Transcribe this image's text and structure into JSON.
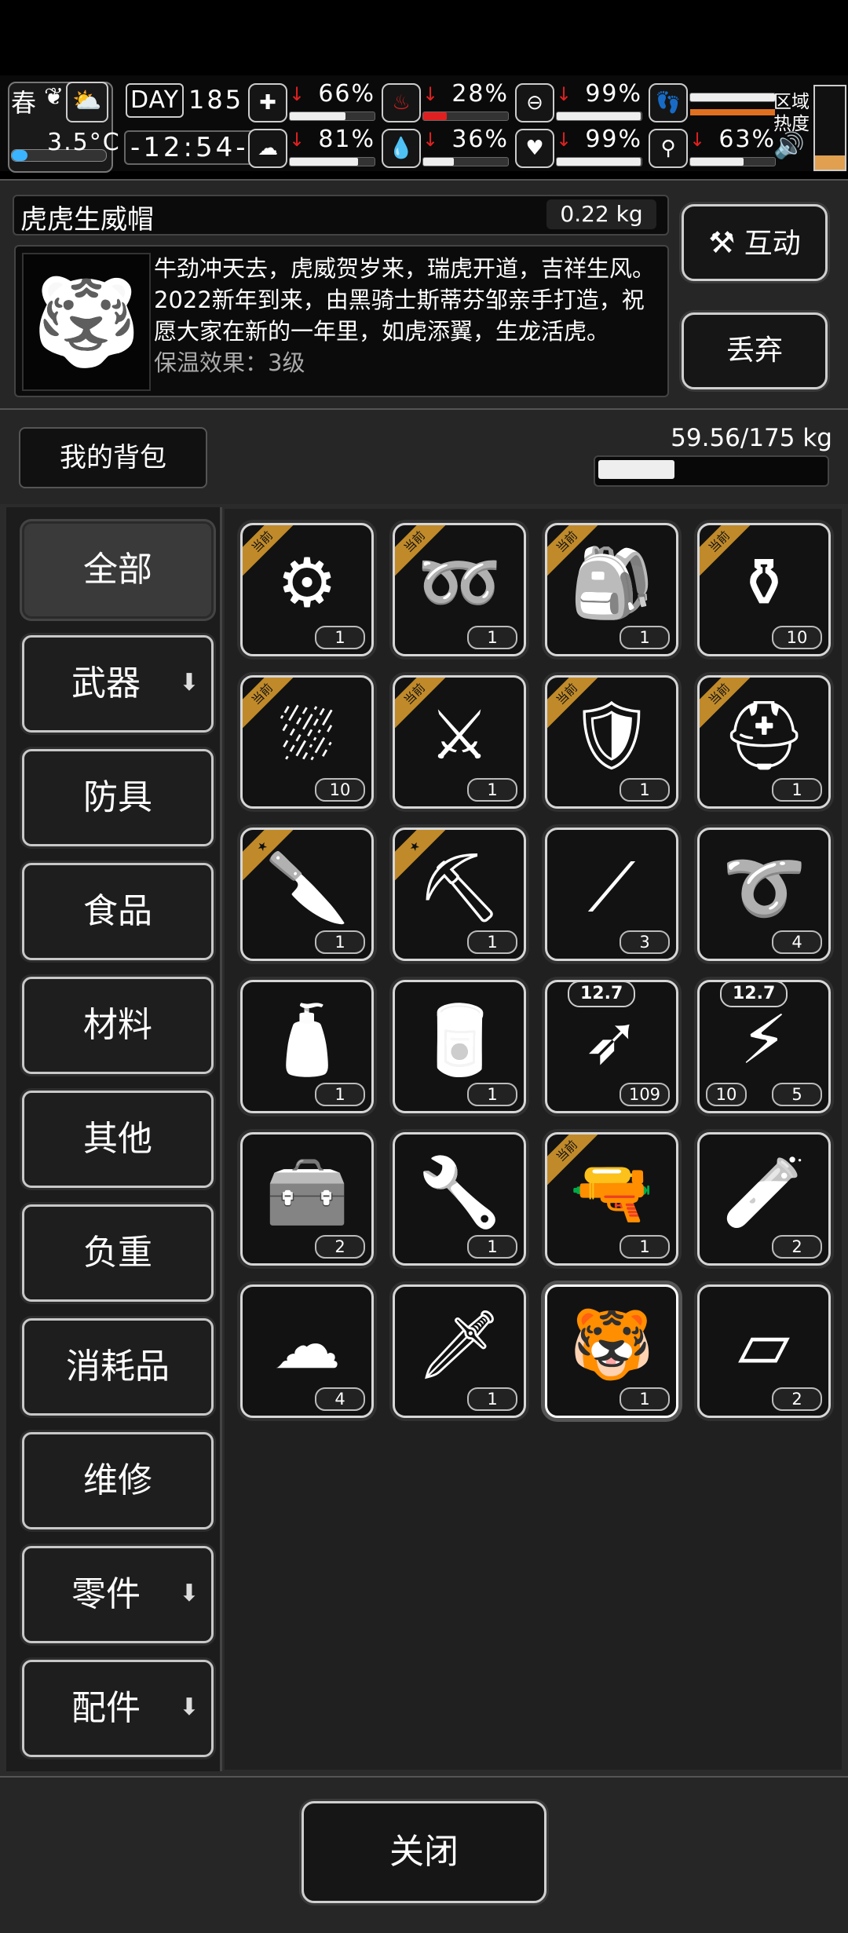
{
  "status": {
    "season": "春",
    "temperature": "3.5°C",
    "day_label": "DAY",
    "day_number": "185",
    "clock": "-12:54-",
    "stats": [
      {
        "icon": "medkit-icon",
        "value": "66%",
        "fill": 0.66
      },
      {
        "icon": "stomach-icon",
        "value": "28%",
        "fill": 0.28
      },
      {
        "icon": "bladder-icon",
        "value": "99%",
        "fill": 0.99
      },
      {
        "icon": "stamina-foot-icon",
        "value": "",
        "fill": 1.0
      },
      {
        "icon": "brain-icon",
        "value": "81%",
        "fill": 0.81
      },
      {
        "icon": "water-drop-icon",
        "value": "36%",
        "fill": 0.36
      },
      {
        "icon": "heart-icon",
        "value": "99%",
        "fill": 0.99
      },
      {
        "icon": "fatigue-icon",
        "value": "63%",
        "fill": 0.63
      }
    ],
    "region_heat_label": "区域\n热度",
    "sound_icon": "speaker-icon"
  },
  "item": {
    "name": "虎虎生威帽",
    "weight": "0.22 kg",
    "description": "牛劲冲天去，虎威贺岁来，瑞虎开道，吉祥生风。2022新年到来，由黑骑士斯蒂芬邹亲手打造，祝愿大家在新的一年里，如虎添翼，生龙活虎。",
    "description_cut": "保温效果：3级",
    "interact_label": "互动",
    "discard_label": "丢弃"
  },
  "bag": {
    "title": "我的背包",
    "weight_text": "59.56/175 kg",
    "fill": 0.34
  },
  "categories": [
    {
      "label": "全部",
      "selected": true,
      "arrow": false
    },
    {
      "label": "武器",
      "selected": false,
      "arrow": true
    },
    {
      "label": "防具",
      "selected": false,
      "arrow": false
    },
    {
      "label": "食品",
      "selected": false,
      "arrow": false
    },
    {
      "label": "材料",
      "selected": false,
      "arrow": false
    },
    {
      "label": "其他",
      "selected": false,
      "arrow": false
    },
    {
      "label": "负重",
      "selected": false,
      "arrow": false
    },
    {
      "label": "消耗品",
      "selected": false,
      "arrow": false
    },
    {
      "label": "维修",
      "selected": false,
      "arrow": false
    },
    {
      "label": "零件",
      "selected": false,
      "arrow": true
    },
    {
      "label": "配件",
      "selected": false,
      "arrow": true
    }
  ],
  "items": [
    {
      "glyph": "⚙",
      "icon": "tripod-icon",
      "count": "1",
      "tag": "当前"
    },
    {
      "glyph": "➿",
      "icon": "rope-whip-icon",
      "count": "1",
      "tag": "当前"
    },
    {
      "glyph": "🎒",
      "icon": "backpack-icon",
      "count": "1",
      "tag": "当前"
    },
    {
      "glyph": "⚱",
      "icon": "grenade-icon",
      "count": "10",
      "tag": "当前"
    },
    {
      "glyph": "⛆",
      "icon": "net-icon",
      "count": "10",
      "tag": "当前"
    },
    {
      "glyph": "⚔",
      "icon": "armor-gauntlet-icon",
      "count": "1",
      "tag": "当前"
    },
    {
      "glyph": "🛡",
      "icon": "body-armor-icon",
      "count": "1",
      "tag": "当前"
    },
    {
      "glyph": "⛑",
      "icon": "helmet-icon",
      "count": "1",
      "tag": "当前"
    },
    {
      "glyph": "🔪",
      "icon": "knife-icon",
      "count": "1",
      "tag": "★"
    },
    {
      "glyph": "⛏",
      "icon": "shovel-icon",
      "count": "1",
      "tag": "★"
    },
    {
      "glyph": "⟋",
      "icon": "lockpick-icon",
      "count": "3",
      "tag": ""
    },
    {
      "glyph": "➰",
      "icon": "rope-icon",
      "count": "4",
      "tag": ""
    },
    {
      "glyph": "🧴",
      "icon": "water-bottle-icon",
      "count": "1",
      "tag": ""
    },
    {
      "glyph": "🥫",
      "icon": "canned-food-icon",
      "count": "1",
      "tag": ""
    },
    {
      "glyph": "➶",
      "icon": "bullet-icon",
      "count": "109",
      "tag": "",
      "caliber": "12.7"
    },
    {
      "glyph": "⚡",
      "icon": "ammo-box-icon",
      "count": "5",
      "count2": "10",
      "tag": "",
      "caliber": "12.7"
    },
    {
      "glyph": "🧰",
      "icon": "toolbox-icon",
      "count": "2",
      "tag": ""
    },
    {
      "glyph": "🔧",
      "icon": "tool-bag-icon",
      "count": "1",
      "tag": ""
    },
    {
      "glyph": "🔫",
      "icon": "minigun-icon",
      "count": "1",
      "tag": "当前"
    },
    {
      "glyph": "🧪",
      "icon": "beaker-icon",
      "count": "2",
      "tag": ""
    },
    {
      "glyph": "☁",
      "icon": "cloth-icon",
      "count": "4",
      "tag": ""
    },
    {
      "glyph": "🗡",
      "icon": "spear-icon",
      "count": "1",
      "tag": ""
    },
    {
      "glyph": "🐯",
      "icon": "tiger-hat-icon",
      "count": "1",
      "tag": "",
      "selected": true
    },
    {
      "glyph": "▱",
      "icon": "paper-sheets-icon",
      "count": "2",
      "tag": ""
    }
  ],
  "close_label": "关闭"
}
